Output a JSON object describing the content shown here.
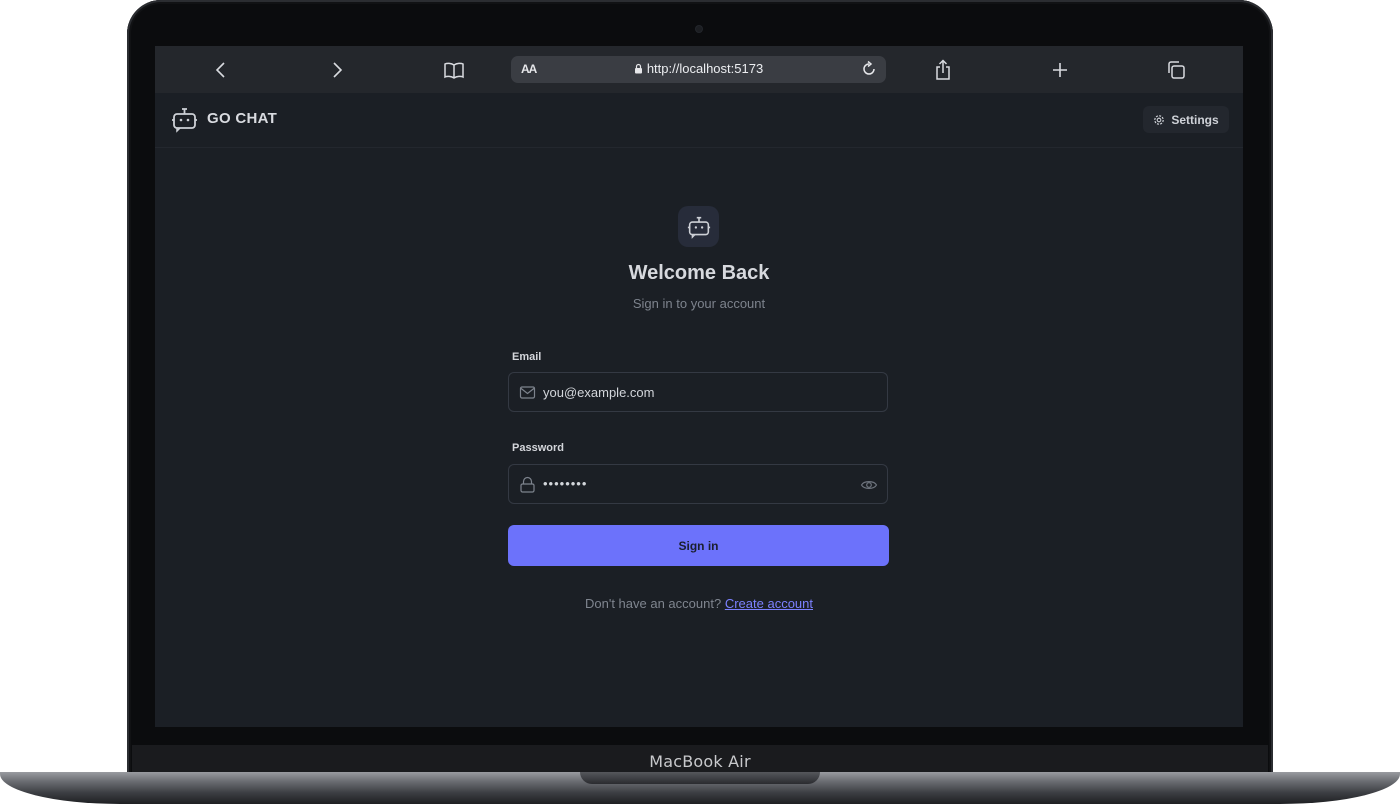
{
  "device": {
    "model_label": "MacBook Air"
  },
  "browser": {
    "text_size_label": "AA",
    "url": "http://localhost:5173",
    "icons": [
      "back-icon",
      "forward-icon",
      "bookmarks-icon",
      "lock-icon",
      "reload-icon",
      "share-icon",
      "new-tab-icon",
      "tabs-icon"
    ]
  },
  "header": {
    "brand": "GO CHAT",
    "settings_label": "Settings"
  },
  "login": {
    "title": "Welcome Back",
    "subtitle": "Sign in to your account",
    "email": {
      "label": "Email",
      "placeholder": "you@example.com"
    },
    "password": {
      "label": "Password",
      "value": "••••••••"
    },
    "submit_label": "Sign in",
    "footer_prompt": "Don't have an account?",
    "footer_link": "Create account"
  },
  "colors": {
    "accent": "#6c72fb",
    "link": "#7c81ff",
    "background": "#1b1f25"
  }
}
